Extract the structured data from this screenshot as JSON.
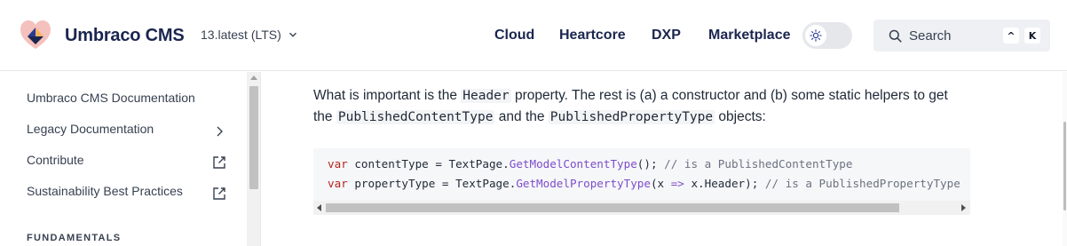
{
  "header": {
    "brand": "Umbraco CMS",
    "version": "13.latest (LTS)",
    "nav": [
      "Cloud",
      "Heartcore",
      "DXP",
      "Marketplace"
    ],
    "search_placeholder": "Search",
    "shortcut_keys": [
      "^",
      "K"
    ],
    "theme_icon": "sun-icon"
  },
  "sidebar": {
    "items": [
      {
        "label": "Umbraco CMS Documentation",
        "trail": "none"
      },
      {
        "label": "Legacy Documentation",
        "trail": "chevron-right-icon"
      },
      {
        "label": "Contribute",
        "trail": "external-link-icon"
      },
      {
        "label": "Sustainability Best Practices",
        "trail": "external-link-icon"
      }
    ],
    "section": "FUNDAMENTALS"
  },
  "main": {
    "para": {
      "t1": "What is important is the ",
      "c1": "Header",
      "t2": " property. The rest is (a) a constructor and (b) some static helpers to get the ",
      "c2": "PublishedContentType",
      "t3": " and the ",
      "c3": "PublishedPropertyType",
      "t4": " objects:"
    },
    "code": {
      "line1": {
        "kw": "var",
        "a": " contentType = TextPage.",
        "fn": "GetModelContentType",
        "b": "(); ",
        "cm": "// is a PublishedContentType"
      },
      "line2": {
        "kw": "var",
        "a": " propertyType = TextPage.",
        "fn": "GetModelPropertyType",
        "b": "(x ",
        "op": "=>",
        "c": " x.Header); ",
        "cm": "// is a PublishedPropertyType"
      }
    }
  },
  "colors": {
    "brand_navy": "#1b264f",
    "keyword": "#b3261e",
    "function": "#7c4dcc",
    "comment": "#6b7280",
    "logo_pink": "#f5c1bc",
    "logo_navy": "#283a97"
  }
}
